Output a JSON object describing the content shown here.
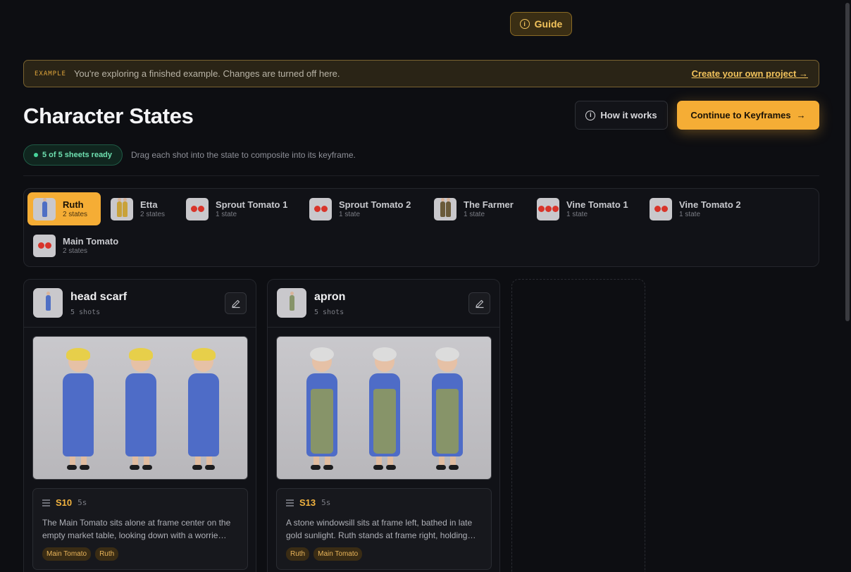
{
  "header": {
    "guide_label": "Guide",
    "guide_icon": "info-icon"
  },
  "banner": {
    "tag": "EXAMPLE",
    "text": "You're exploring a finished example. Changes are turned off here.",
    "link": "Create your own project →"
  },
  "page": {
    "title": "Character States",
    "how_it_works": "How it works",
    "continue_label": "Continue to Keyframes",
    "continue_arrow": "→",
    "ready_badge": "5 of 5 sheets ready",
    "hint": "Drag each shot into the state to composite into its keyframe."
  },
  "characters": [
    {
      "name": "Ruth",
      "states": "2 states",
      "active": true,
      "icon": "person-thumb-icon"
    },
    {
      "name": "Etta",
      "states": "2 states",
      "active": false,
      "icon": "person-thumb-icon"
    },
    {
      "name": "Sprout Tomato 1",
      "states": "1 state",
      "active": false,
      "icon": "tomato-thumb-icon"
    },
    {
      "name": "Sprout Tomato 2",
      "states": "1 state",
      "active": false,
      "icon": "tomato-thumb-icon"
    },
    {
      "name": "The Farmer",
      "states": "1 state",
      "active": false,
      "icon": "person-thumb-icon"
    },
    {
      "name": "Vine Tomato 1",
      "states": "1 state",
      "active": false,
      "icon": "tomato-thumb-icon"
    },
    {
      "name": "Vine Tomato 2",
      "states": "1 state",
      "active": false,
      "icon": "tomato-thumb-icon"
    },
    {
      "name": "Main Tomato",
      "states": "2 states",
      "active": false,
      "icon": "tomato-thumb-icon"
    }
  ],
  "states": [
    {
      "title": "head scarf",
      "shots": "5 shots",
      "shot": {
        "id": "S10",
        "duration": "5s",
        "description": "The Main Tomato sits alone at frame center on the empty market table, looking down with a worrie…",
        "tags": [
          "Main Tomato",
          "Ruth"
        ]
      }
    },
    {
      "title": "apron",
      "shots": "5 shots",
      "shot": {
        "id": "S13",
        "duration": "5s",
        "description": "A stone windowsill sits at frame left, bathed in late gold sunlight. Ruth stands at frame right, holding…",
        "tags": [
          "Ruth",
          "Main Tomato"
        ]
      }
    }
  ],
  "colors": {
    "accent": "#f5ad35",
    "background": "#0d0e12",
    "success": "#47d49a"
  }
}
